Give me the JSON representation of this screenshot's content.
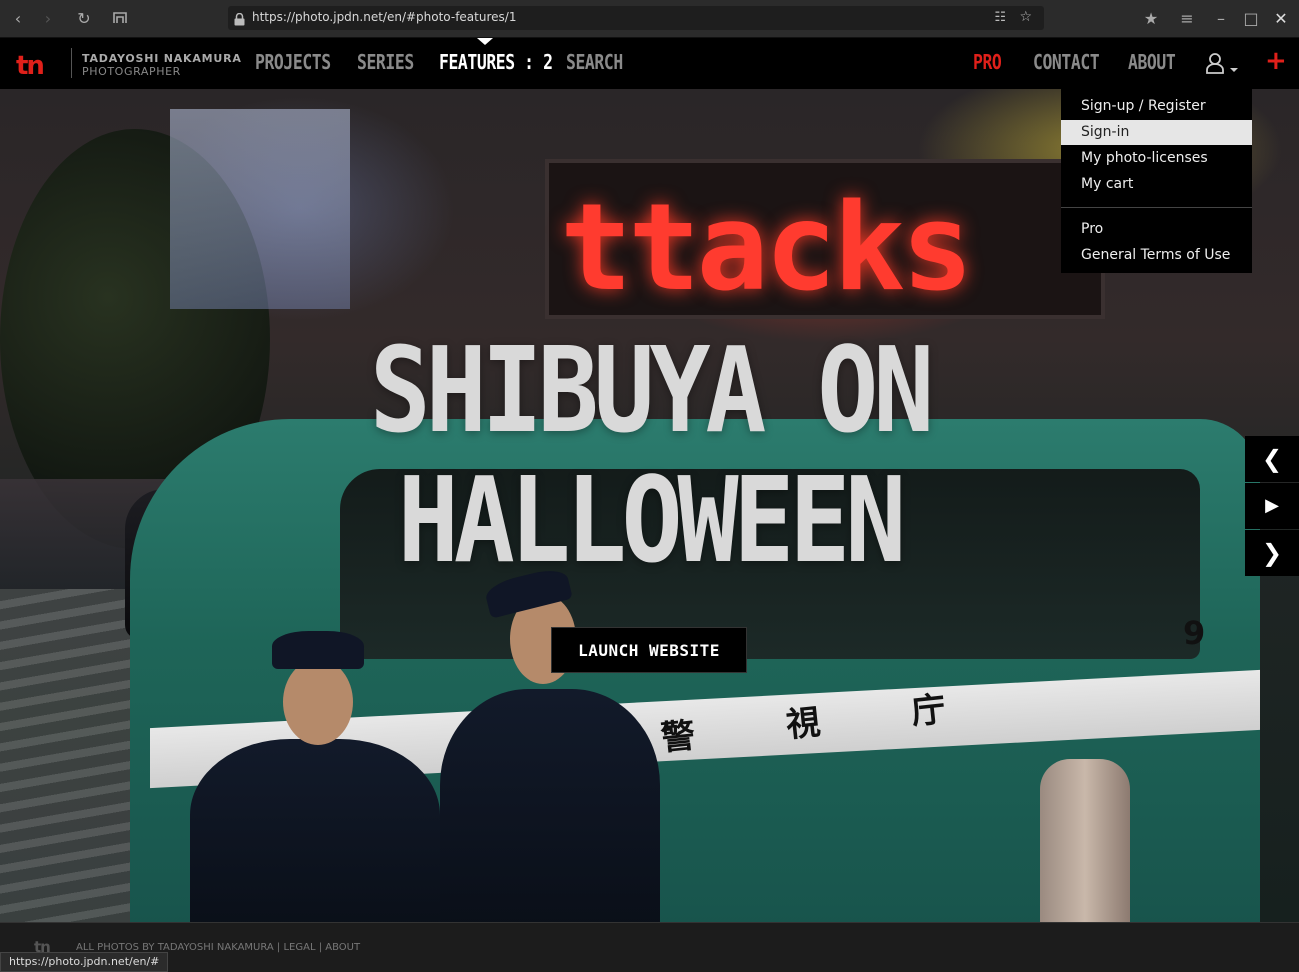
{
  "browser": {
    "url": "https://photo.jpdn.net/en/#photo-features/1",
    "status_url": "https://photo.jpdn.net/en/#"
  },
  "site": {
    "logo": "tn",
    "brand_name": "TADAYOSHI NAKAMURA",
    "brand_sub": "PHOTOGRAPHER",
    "accent_color": "#e0201a"
  },
  "nav": {
    "projects": "PROJECTS",
    "series": "SERIES",
    "features": "FEATURES : 2",
    "search": "SEARCH",
    "pro": "PRO",
    "contact": "CONTACT",
    "about": "ABOUT",
    "plus": "+"
  },
  "hero": {
    "title_line1": "SHIBUYA ON",
    "title_line2": "HALLOWEEN",
    "launch_label": "LAUNCH WEBSITE",
    "led_text": "ttacks",
    "van_number": "9",
    "van_kanji": "警 視 庁",
    "prev_icon": "❮",
    "play_icon": "▶",
    "next_icon": "❯"
  },
  "user_menu": {
    "items": [
      {
        "label": "Sign-up / Register"
      },
      {
        "label": "Sign-in",
        "hover": true
      },
      {
        "label": "My photo-licenses"
      },
      {
        "label": "My cart"
      },
      {
        "label": "Pro"
      },
      {
        "label": "General Terms of Use"
      }
    ]
  },
  "footer": {
    "logo": "tn",
    "text": "ALL PHOTOS BY TADAYOSHI NAKAMURA | LEGAL | ABOUT"
  }
}
